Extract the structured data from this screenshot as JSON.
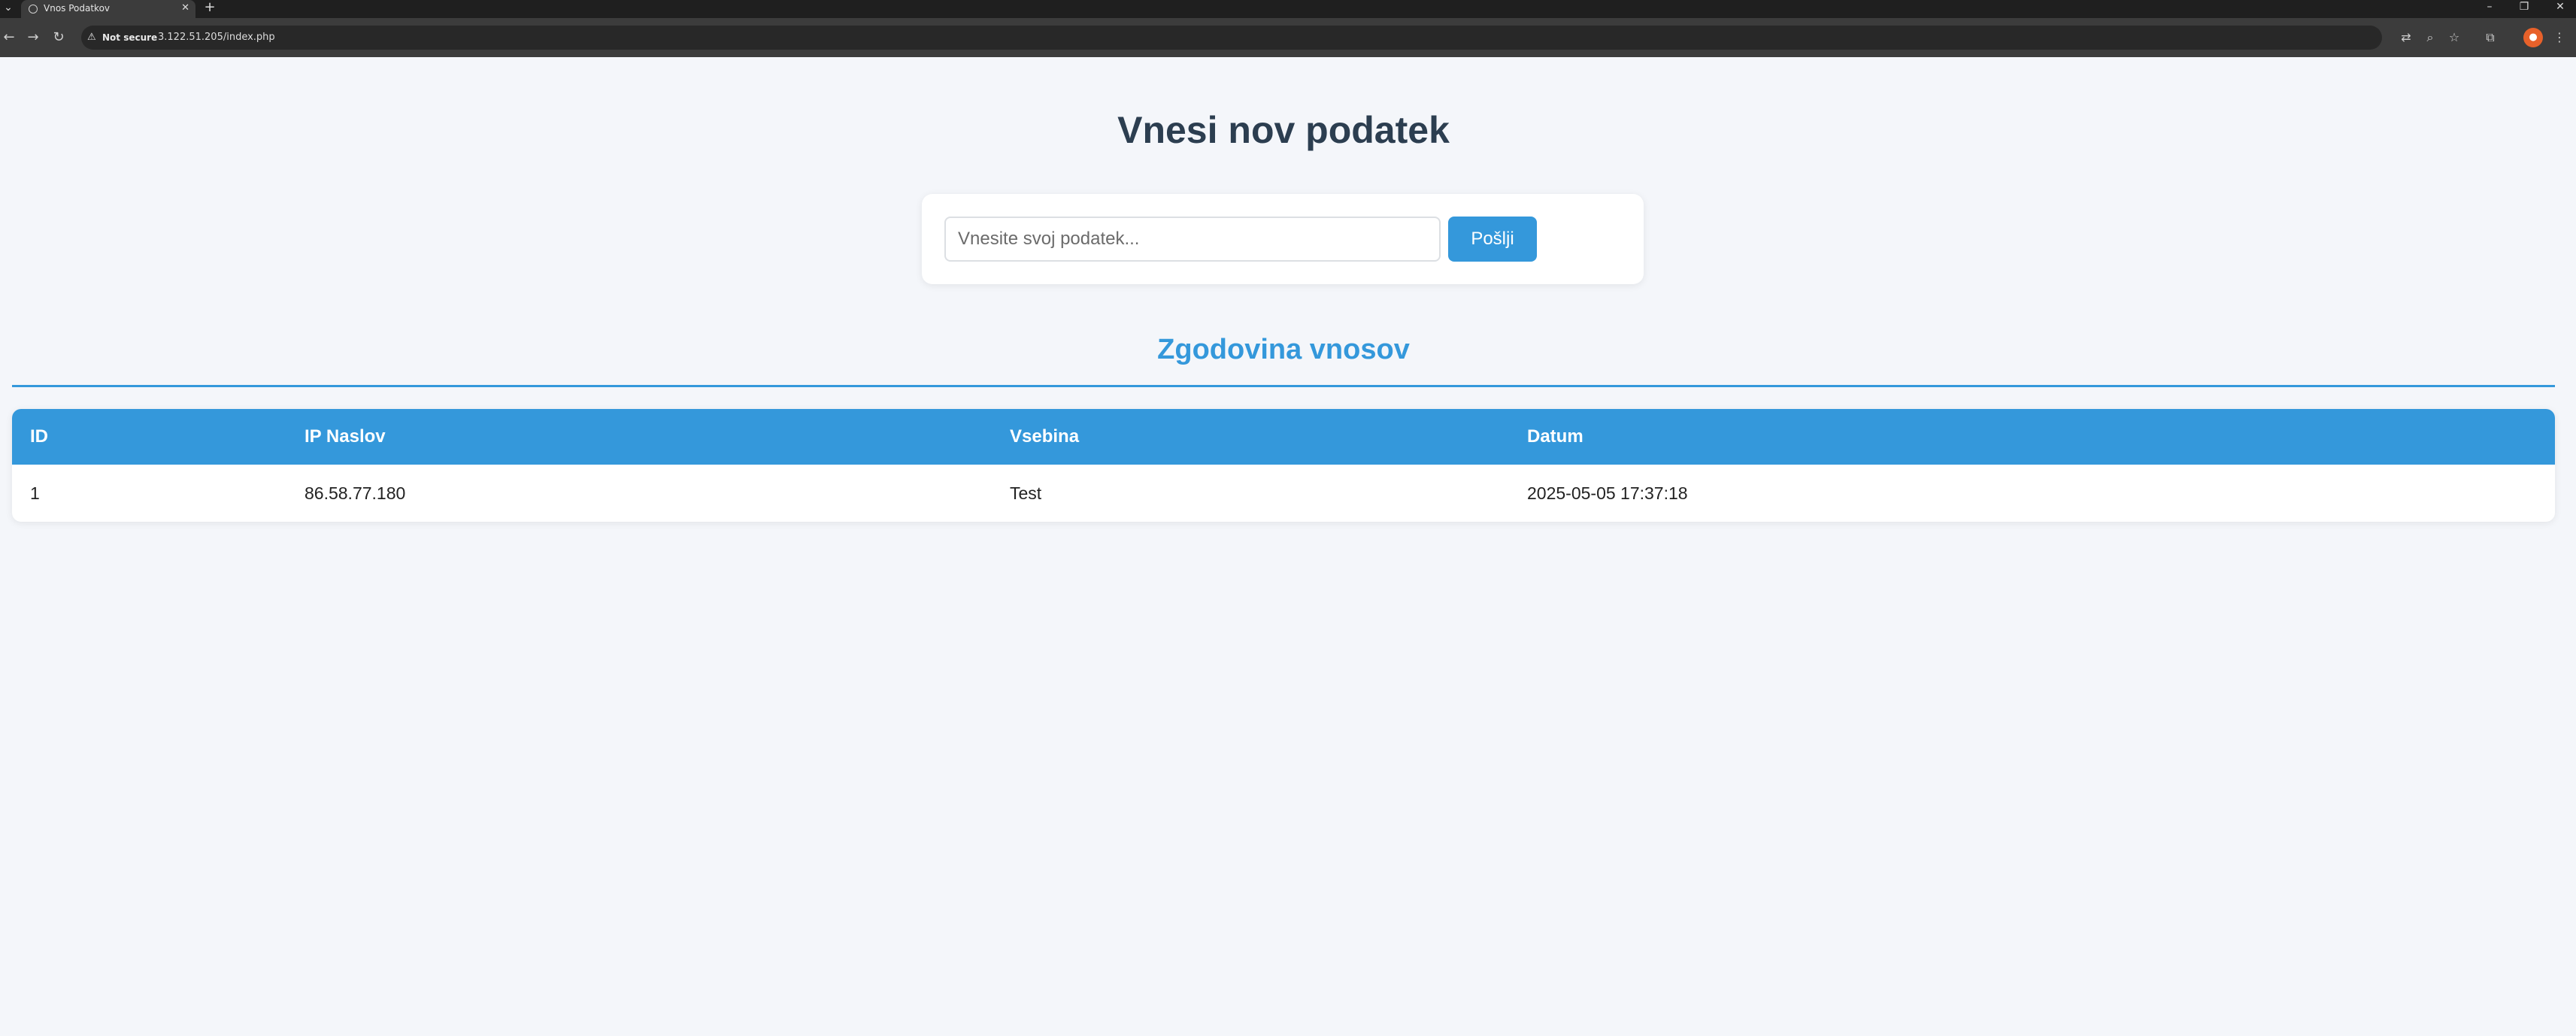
{
  "browser": {
    "tab_title": "Vnos Podatkov",
    "tab_close": "✕",
    "new_tab": "+",
    "tab_list": "⌄",
    "window": {
      "minimize": "–",
      "restore": "❐",
      "close": "✕"
    },
    "nav": {
      "back": "←",
      "forward": "→",
      "reload": "↻"
    },
    "security_warning_icon": "⚠",
    "security_label": "Not secure",
    "url": "3.122.51.205/index.php",
    "toolbar_icons": {
      "translate": "⇄",
      "zoom": "⌕",
      "bookmark": "☆",
      "extensions": "⧉",
      "menu": "⋮"
    },
    "profile_initial": "●"
  },
  "page": {
    "title": "Vnesi nov podatek",
    "form": {
      "input_placeholder": "Vnesite svoj podatek...",
      "input_value": "",
      "submit_label": "Pošlji"
    },
    "history_title": "Zgodovina vnosov",
    "table": {
      "headers": [
        "ID",
        "IP Naslov",
        "Vsebina",
        "Datum"
      ],
      "rows": [
        [
          "1",
          "86.58.77.180",
          "Test",
          "2025-05-05 17:37:18"
        ]
      ]
    }
  },
  "colors": {
    "accent": "#3498db",
    "heading": "#2c3e50",
    "background": "#f4f6fa"
  }
}
